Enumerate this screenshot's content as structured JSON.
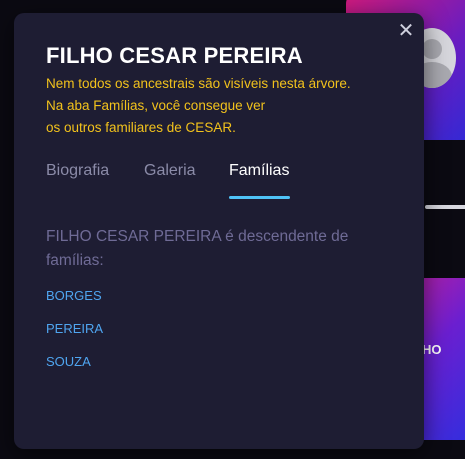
{
  "background": {
    "card_partial_text": "HO"
  },
  "modal": {
    "title": "FILHO CESAR PEREIRA",
    "notice_lines": [
      "Nem todos os ancestrais são visíveis nesta árvore.",
      "Na aba Famílias, você consegue ver",
      "os outros familiares de CESAR."
    ],
    "close_icon": "close-icon",
    "tabs": [
      {
        "label": "Biografia",
        "active": false
      },
      {
        "label": "Galeria",
        "active": false
      },
      {
        "label": "Famílias",
        "active": true
      }
    ],
    "description": "FILHO CESAR PEREIRA é descendente de famílias:",
    "families": [
      "BORGES",
      "PEREIRA",
      "SOUZA"
    ]
  },
  "colors": {
    "modal_bg": "#1e1d33",
    "notice": "#f2c21c",
    "tab_inactive": "#8b8ba8",
    "tab_underline": "#4fc3f7",
    "link": "#4fa5f0",
    "description": "#6f6b96"
  }
}
